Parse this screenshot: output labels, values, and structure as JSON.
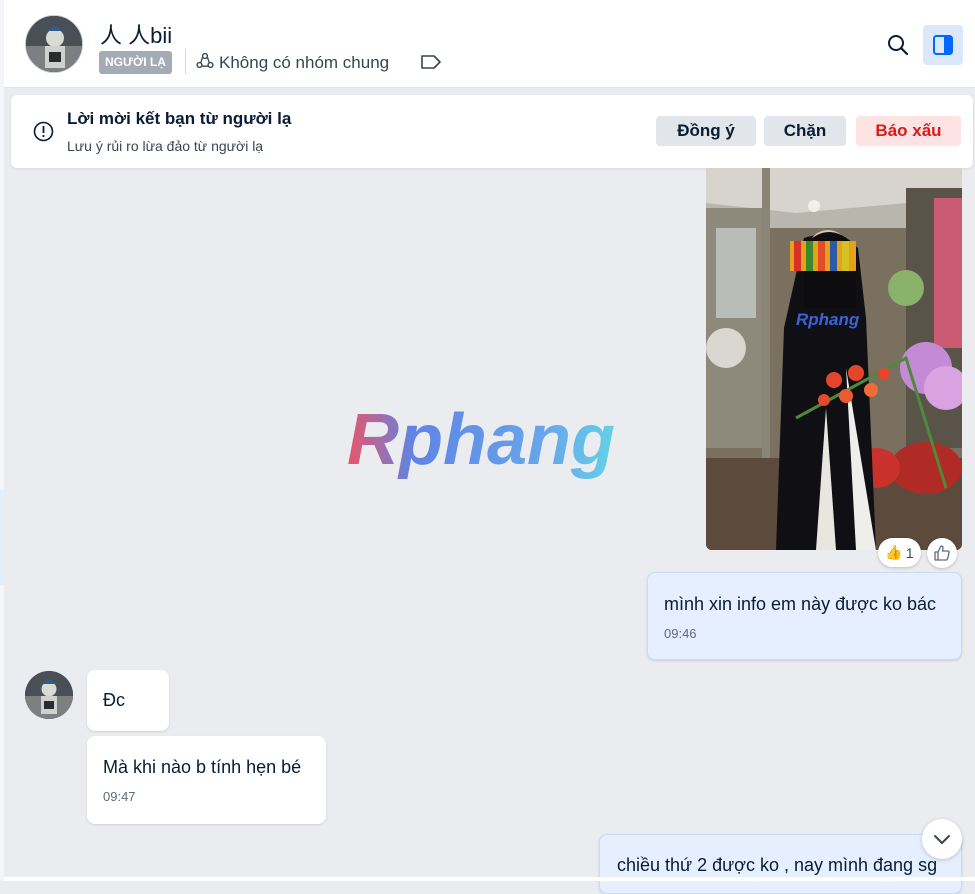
{
  "header": {
    "contact_name": "人 人bii",
    "stranger_badge": "NGƯỜI LẠ",
    "common_groups": "Không có nhóm chung"
  },
  "friend_request": {
    "title": "Lời mời kết bạn từ người lạ",
    "subtitle": "Lưu ý rủi ro lừa đảo từ người lạ",
    "accept_label": "Đồng ý",
    "block_label": "Chặn",
    "report_label": "Báo xấu"
  },
  "watermark": {
    "text": "Rphang"
  },
  "photo_message": {
    "reaction_emoji": "👍",
    "reaction_count": "1"
  },
  "messages": [
    {
      "sender": "me",
      "text": "mình xin info em này được ko bác",
      "time": "09:46"
    },
    {
      "sender": "them",
      "text": "Đc",
      "time": ""
    },
    {
      "sender": "them",
      "text": "Mà khi nào b tính hẹn bé",
      "time": "09:47"
    },
    {
      "sender": "me",
      "text": "chiều thứ 2 được ko , nay mình đang sg",
      "time": ""
    }
  ],
  "colors": {
    "accent": "#0068ff",
    "my_bubble": "#e5efff",
    "their_bubble": "#ffffff",
    "report_text": "#d91b1b",
    "background": "#ebecf0"
  }
}
